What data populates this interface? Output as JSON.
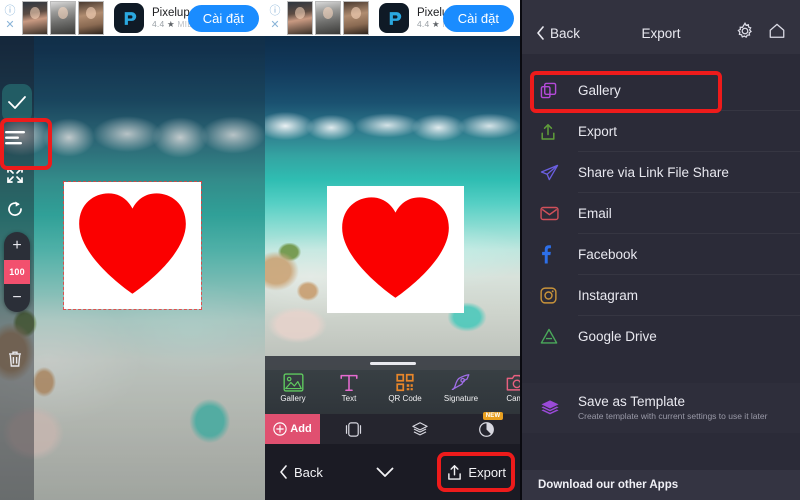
{
  "ad_banner": {
    "app_name": "Pixelup",
    "rating": "4.4",
    "star": "★",
    "price_label": "MIỄN PHÍ",
    "cta_label": "Cài đặt",
    "info_icon": "ⓘ",
    "close_icon": "✕"
  },
  "left_panel": {
    "rail": {
      "confirm_label": "check-icon",
      "menu_label": "lines-icon",
      "expand_label": "expand-icon",
      "rotate_label": "rotate-icon",
      "zoom_in": "+",
      "zoom_value": "100",
      "zoom_out": "−",
      "delete_label": "trash-icon"
    }
  },
  "middle_panel": {
    "tools": [
      {
        "label": "Gallery",
        "color": "#5fc95f"
      },
      {
        "label": "Text",
        "color": "#e56bd0"
      },
      {
        "label": "QR Code",
        "color": "#e8862a"
      },
      {
        "label": "Signature",
        "color": "#a06ee8"
      },
      {
        "label": "Came",
        "color": "#e8607f"
      }
    ],
    "add_button": "Add",
    "new_badge": "NEW",
    "back_label": "Back",
    "export_label": "Export"
  },
  "right_panel": {
    "header": {
      "back_label": "Back",
      "title": "Export",
      "settings_icon": "gear-icon",
      "home_icon": "home-icon"
    },
    "items": [
      {
        "label": "Gallery",
        "icon": "gallery-icon",
        "color": "#b44ad8"
      },
      {
        "label": "Export",
        "icon": "export-icon",
        "color": "#5f9e3a"
      },
      {
        "label": "Share via Link File Share",
        "icon": "send-icon",
        "color": "#6a5fe0"
      },
      {
        "label": "Email",
        "icon": "email-icon",
        "color": "#d0505a"
      },
      {
        "label": "Facebook",
        "icon": "facebook-icon",
        "color": "#2d6fe8"
      },
      {
        "label": "Instagram",
        "icon": "instagram-icon",
        "color": "#c9943a"
      },
      {
        "label": "Google Drive",
        "icon": "gdrive-icon",
        "color": "#4aa85a"
      }
    ],
    "template": {
      "title": "Save as Template",
      "subtitle": "Create template with current settings to use it later",
      "icon": "layers-icon",
      "color": "#9b4ad8"
    },
    "footer": {
      "label": "Download our other Apps"
    }
  },
  "highlights": {
    "accent_color": "#ee1b1b"
  }
}
